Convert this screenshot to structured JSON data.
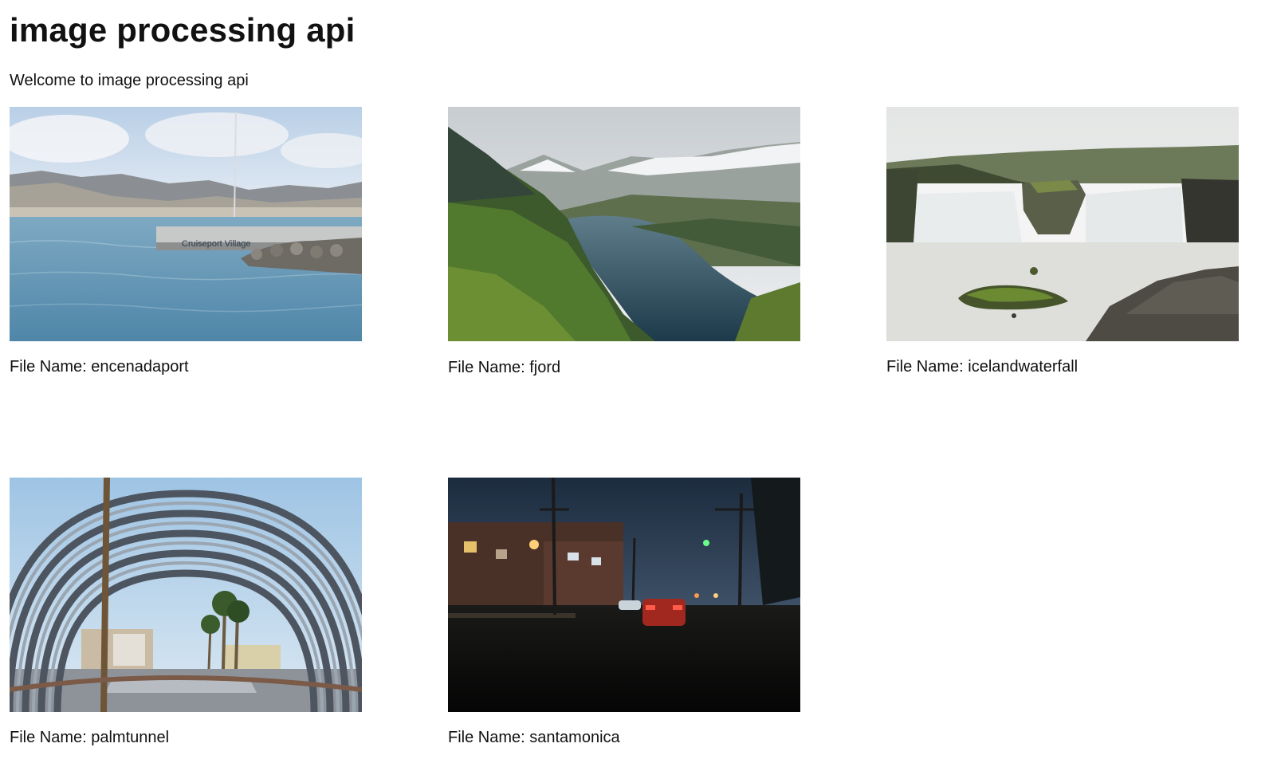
{
  "page": {
    "title": "image processing api",
    "welcome": "Welcome to image processing api"
  },
  "gallery": {
    "label_prefix": "File Name:",
    "images": [
      {
        "file_name": "encenadaport",
        "caption": "File Name: encenadaport",
        "sign_text": "Cruiseport Village"
      },
      {
        "file_name": "fjord",
        "caption": "File Name: fjord"
      },
      {
        "file_name": "icelandwaterfall",
        "caption": "File Name: icelandwaterfall"
      },
      {
        "file_name": "palmtunnel",
        "caption": "File Name: palmtunnel"
      },
      {
        "file_name": "santamonica",
        "caption": "File Name: santamonica"
      }
    ]
  },
  "colors": {
    "background": "#ffffff",
    "text": "#111111"
  }
}
